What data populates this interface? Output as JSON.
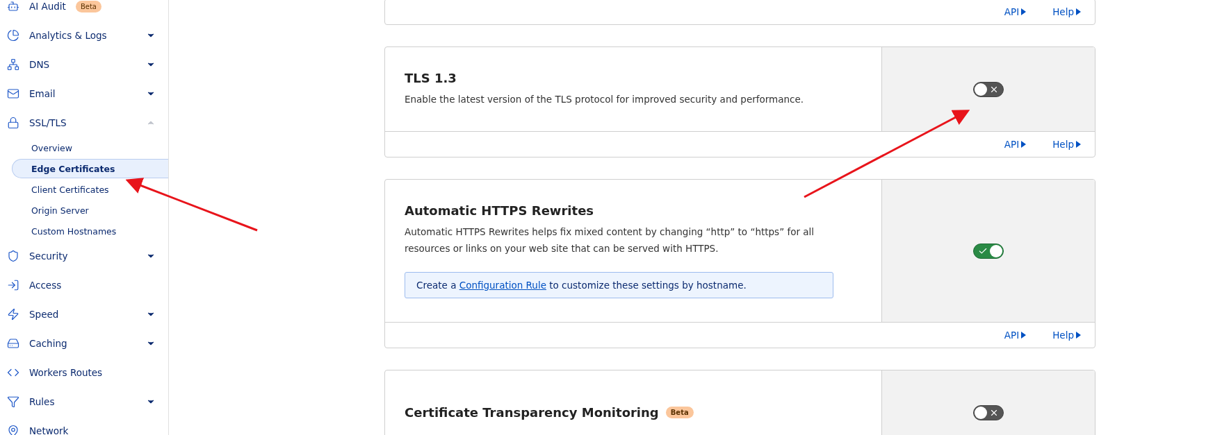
{
  "sidebar": {
    "items": [
      {
        "kind": "link",
        "label": "AI Audit",
        "badge": "Beta"
      },
      {
        "kind": "group",
        "label": "Analytics & Logs",
        "expanded": false
      },
      {
        "kind": "group",
        "label": "DNS",
        "expanded": false
      },
      {
        "kind": "group",
        "label": "Email",
        "expanded": false
      },
      {
        "kind": "group",
        "label": "SSL/TLS",
        "expanded": true,
        "children": [
          {
            "label": "Overview",
            "selected": false
          },
          {
            "label": "Edge Certificates",
            "selected": true
          },
          {
            "label": "Client Certificates",
            "selected": false
          },
          {
            "label": "Origin Server",
            "selected": false
          },
          {
            "label": "Custom Hostnames",
            "selected": false
          }
        ]
      },
      {
        "kind": "group",
        "label": "Security",
        "expanded": false
      },
      {
        "kind": "link",
        "label": "Access"
      },
      {
        "kind": "group",
        "label": "Speed",
        "expanded": false
      },
      {
        "kind": "group",
        "label": "Caching",
        "expanded": false
      },
      {
        "kind": "link",
        "label": "Workers Routes"
      },
      {
        "kind": "group",
        "label": "Rules",
        "expanded": false
      },
      {
        "kind": "link",
        "label": "Network"
      }
    ]
  },
  "cards": [
    {
      "kind": "partial",
      "links": [
        "API",
        "Help"
      ]
    },
    {
      "kind": "setting",
      "title": "TLS 1.3",
      "description": "Enable the latest version of the TLS protocol for improved security and performance.",
      "on": false,
      "links": [
        "API",
        "Help"
      ]
    },
    {
      "kind": "setting",
      "title": "Automatic HTTPS Rewrites",
      "description": "Automatic HTTPS Rewrites helps fix mixed content by changing “http” to “https” for all resources or links on your web site that can be served with HTTPS.",
      "on": true,
      "info": {
        "before": "Create a",
        "link": "Configuration Rule",
        "after": "to customize these settings by hostname."
      },
      "links": [
        "API",
        "Help"
      ]
    },
    {
      "kind": "setting",
      "title": "Certificate Transparency Monitoring",
      "badge": "Beta",
      "on": false
    }
  ]
}
